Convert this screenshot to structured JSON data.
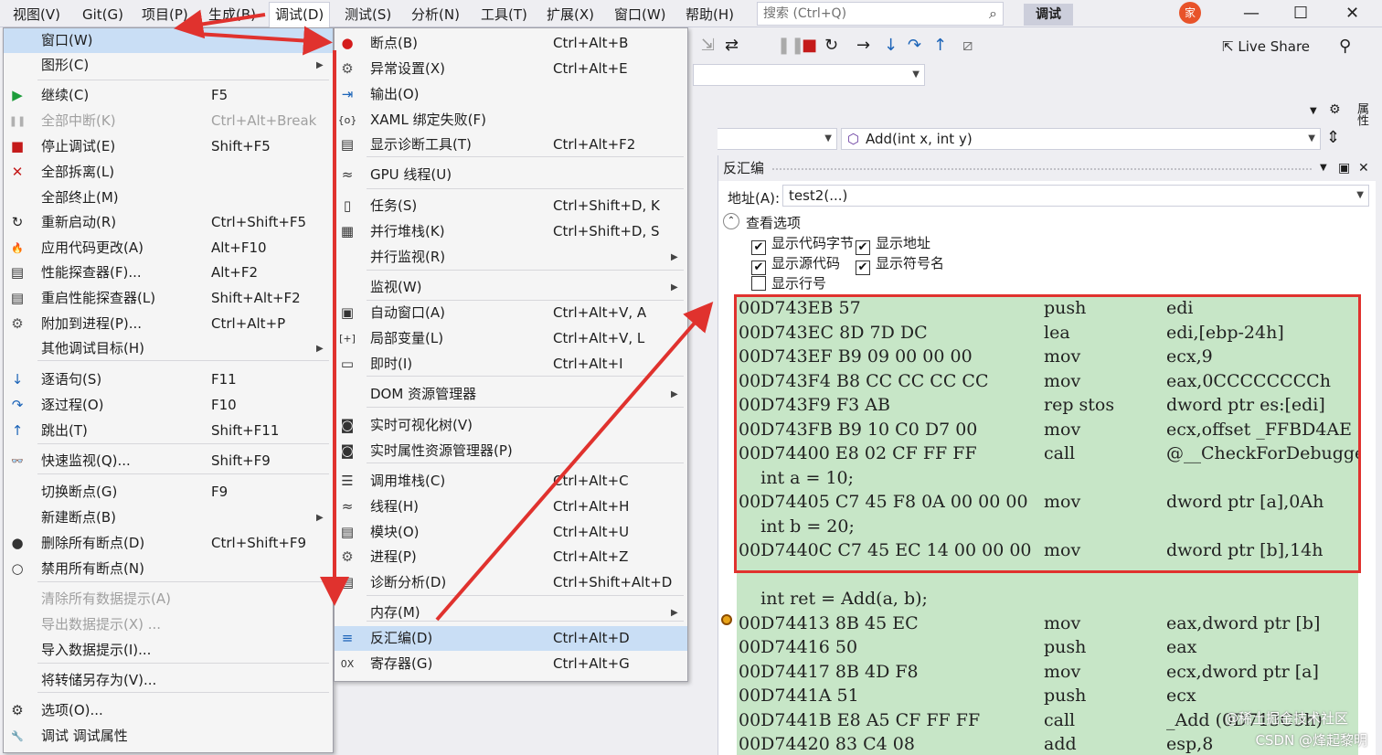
{
  "menubar": {
    "items": [
      "视图(V)",
      "Git(G)",
      "项目(P)",
      "生成(B)",
      "调试(D)",
      "测试(S)",
      "分析(N)",
      "工具(T)",
      "扩展(X)",
      "窗口(W)",
      "帮助(H)"
    ],
    "search_placeholder": "搜索 (Ctrl+Q)",
    "mode_badge": "调试",
    "avatar_text": "家",
    "live_share": "Live Share"
  },
  "combos": {
    "func": "Add(int x, int y)"
  },
  "panel": {
    "title": "反汇编",
    "address_label": "地址(A):",
    "address_value": "test2(...)",
    "view_options": "查看选项",
    "opts": [
      "显示代码字节",
      "显示地址",
      "显示源代码",
      "显示符号名",
      "显示行号"
    ]
  },
  "code": [
    [
      "00D743EB 57",
      "push",
      "edi"
    ],
    [
      "00D743EC 8D 7D DC",
      "lea",
      "edi,[ebp-24h]"
    ],
    [
      "00D743EF B9 09 00 00 00",
      "mov",
      "ecx,9"
    ],
    [
      "00D743F4 B8 CC CC CC CC",
      "mov",
      "eax,0CCCCCCCCh"
    ],
    [
      "00D743F9 F3 AB",
      "rep stos",
      "dword ptr es:[edi]"
    ],
    [
      "00D743FB B9 10 C0 D7 00",
      "mov",
      "ecx,offset _FFBD4AE"
    ],
    [
      "00D74400 E8 02 CF FF FF",
      "call",
      "@__CheckForDebuggerJ"
    ],
    [
      "    int a = 10;",
      "",
      ""
    ],
    [
      "00D74405 C7 45 F8 0A 00 00 00",
      "mov",
      "dword ptr [a],0Ah"
    ],
    [
      "    int b = 20;",
      "",
      ""
    ],
    [
      "00D7440C C7 45 EC 14 00 00 00",
      "mov",
      "dword ptr [b],14h"
    ],
    [
      "",
      "",
      ""
    ],
    [
      "    int ret = Add(a, b);",
      "",
      ""
    ],
    [
      "00D74413 8B 45 EC",
      "mov",
      "eax,dword ptr [b]"
    ],
    [
      "00D74416 50",
      "push",
      "eax"
    ],
    [
      "00D74417 8B 4D F8",
      "mov",
      "ecx,dword ptr [a]"
    ],
    [
      "00D7441A 51",
      "push",
      "ecx"
    ],
    [
      "00D7441B E8 A5 CF FF FF",
      "call",
      "_Add (0D713C5h)"
    ],
    [
      "00D74420 83 C4 08",
      "add",
      "esp,8"
    ]
  ],
  "debug_menu": [
    {
      "label": "窗口(W)",
      "sc": "",
      "icon": "",
      "arrow": false,
      "dis": false,
      "hl": true
    },
    {
      "label": "图形(C)",
      "sc": "",
      "icon": "",
      "arrow": true,
      "dis": false
    },
    {
      "label": "继续(C)",
      "sc": "F5",
      "icon": "▶",
      "color": "#1c9c3a",
      "dis": false
    },
    {
      "label": "全部中断(K)",
      "sc": "Ctrl+Alt+Break",
      "icon": "❚❚",
      "color": "#b0b0b0",
      "dis": true
    },
    {
      "label": "停止调试(E)",
      "sc": "Shift+F5",
      "icon": "■",
      "color": "#c41a1a",
      "dis": false
    },
    {
      "label": "全部拆离(L)",
      "sc": "",
      "icon": "✕",
      "color": "#c41a1a",
      "dis": false
    },
    {
      "label": "全部终止(M)",
      "sc": "",
      "icon": "",
      "dis": false
    },
    {
      "label": "重新启动(R)",
      "sc": "Ctrl+Shift+F5",
      "icon": "↻",
      "color": "#222",
      "dis": false
    },
    {
      "label": "应用代码更改(A)",
      "sc": "Alt+F10",
      "icon": "🔥",
      "color": "#d9431e",
      "dis": false
    },
    {
      "label": "性能探查器(F)...",
      "sc": "Alt+F2",
      "icon": "▤",
      "color": "#333",
      "dis": false
    },
    {
      "label": "重启性能探查器(L)",
      "sc": "Shift+Alt+F2",
      "icon": "▤",
      "color": "#333",
      "dis": false
    },
    {
      "label": "附加到进程(P)...",
      "sc": "Ctrl+Alt+P",
      "icon": "⚙",
      "color": "#555",
      "dis": false
    },
    {
      "label": "其他调试目标(H)",
      "sc": "",
      "icon": "",
      "arrow": true,
      "dis": false
    },
    {
      "label": "逐语句(S)",
      "sc": "F11",
      "icon": "↓",
      "color": "#1c64b8",
      "dis": false
    },
    {
      "label": "逐过程(O)",
      "sc": "F10",
      "icon": "↷",
      "color": "#1c64b8",
      "dis": false
    },
    {
      "label": "跳出(T)",
      "sc": "Shift+F11",
      "icon": "↑",
      "color": "#1c64b8",
      "dis": false
    },
    {
      "label": "快速监视(Q)...",
      "sc": "Shift+F9",
      "icon": "👓",
      "color": "#333",
      "dis": false
    },
    {
      "label": "切换断点(G)",
      "sc": "F9",
      "icon": "",
      "dis": false
    },
    {
      "label": "新建断点(B)",
      "sc": "",
      "icon": "",
      "arrow": true,
      "dis": false
    },
    {
      "label": "删除所有断点(D)",
      "sc": "Ctrl+Shift+F9",
      "icon": "●",
      "color": "#333",
      "dis": false
    },
    {
      "label": "禁用所有断点(N)",
      "sc": "",
      "icon": "○",
      "color": "#333",
      "dis": false
    },
    {
      "label": "清除所有数据提示(A)",
      "sc": "",
      "icon": "",
      "dis": true
    },
    {
      "label": "导出数据提示(X) ...",
      "sc": "",
      "icon": "",
      "dis": true
    },
    {
      "label": "导入数据提示(I)...",
      "sc": "",
      "icon": "",
      "dis": false
    },
    {
      "label": "将转储另存为(V)...",
      "sc": "",
      "icon": "",
      "dis": false
    },
    {
      "label": "选项(O)...",
      "sc": "",
      "icon": "⚙",
      "color": "#333",
      "dis": false
    },
    {
      "label": "调试 调试属性",
      "sc": "",
      "icon": "🔧",
      "color": "#333",
      "dis": false
    }
  ],
  "win_menu": [
    {
      "label": "断点(B)",
      "sc": "Ctrl+Alt+B",
      "icon": "●",
      "color": "#d41b1b"
    },
    {
      "label": "异常设置(X)",
      "sc": "Ctrl+Alt+E",
      "icon": "⚙",
      "color": "#555"
    },
    {
      "label": "输出(O)",
      "sc": "",
      "icon": "⇥",
      "color": "#1c64b8"
    },
    {
      "label": "XAML 绑定失败(F)",
      "sc": "",
      "icon": "{o}",
      "color": "#333"
    },
    {
      "label": "显示诊断工具(T)",
      "sc": "Ctrl+Alt+F2",
      "icon": "▤",
      "color": "#333"
    },
    {
      "label": "GPU 线程(U)",
      "sc": "",
      "icon": "≈",
      "color": "#333"
    },
    {
      "label": "任务(S)",
      "sc": "Ctrl+Shift+D, K",
      "icon": "▯",
      "color": "#333"
    },
    {
      "label": "并行堆栈(K)",
      "sc": "Ctrl+Shift+D, S",
      "icon": "▦",
      "color": "#333"
    },
    {
      "label": "并行监视(R)",
      "sc": "",
      "icon": "",
      "arrow": true
    },
    {
      "label": "监视(W)",
      "sc": "",
      "icon": "",
      "arrow": true
    },
    {
      "label": "自动窗口(A)",
      "sc": "Ctrl+Alt+V, A",
      "icon": "▣",
      "color": "#333"
    },
    {
      "label": "局部变量(L)",
      "sc": "Ctrl+Alt+V, L",
      "icon": "[+]",
      "color": "#333"
    },
    {
      "label": "即时(I)",
      "sc": "Ctrl+Alt+I",
      "icon": "▭",
      "color": "#333"
    },
    {
      "label": "DOM 资源管理器",
      "sc": "",
      "icon": "",
      "arrow": true
    },
    {
      "label": "实时可视化树(V)",
      "sc": "",
      "icon": "◙",
      "color": "#333"
    },
    {
      "label": "实时属性资源管理器(P)",
      "sc": "",
      "icon": "◙",
      "color": "#333"
    },
    {
      "label": "调用堆栈(C)",
      "sc": "Ctrl+Alt+C",
      "icon": "☰",
      "color": "#333"
    },
    {
      "label": "线程(H)",
      "sc": "Ctrl+Alt+H",
      "icon": "≈",
      "color": "#333"
    },
    {
      "label": "模块(O)",
      "sc": "Ctrl+Alt+U",
      "icon": "▤",
      "color": "#333"
    },
    {
      "label": "进程(P)",
      "sc": "Ctrl+Alt+Z",
      "icon": "⚙",
      "color": "#555"
    },
    {
      "label": "诊断分析(D)",
      "sc": "Ctrl+Shift+Alt+D",
      "icon": "▤",
      "color": "#333"
    },
    {
      "label": "内存(M)",
      "sc": "",
      "icon": "",
      "arrow": true
    },
    {
      "label": "反汇编(D)",
      "sc": "Ctrl+Alt+D",
      "icon": "≡",
      "color": "#1c64b8",
      "hl": true
    },
    {
      "label": "寄存器(G)",
      "sc": "Ctrl+Alt+G",
      "icon": "0X",
      "color": "#333"
    }
  ],
  "watermark": "CSDN @烽起黎明",
  "watermark2": "@稀土掘金技术社区",
  "colors": {
    "accent": "#e0322e",
    "code_bg": "#c7e6c7",
    "highlight": "#c9def5"
  }
}
